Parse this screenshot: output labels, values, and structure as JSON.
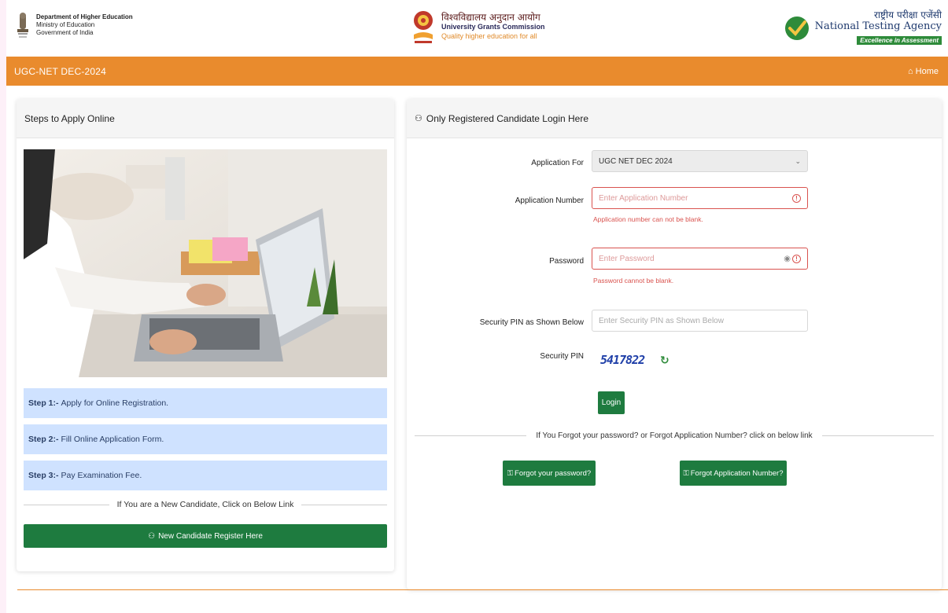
{
  "header": {
    "moe": {
      "line1": "Department of Higher Education",
      "line2": "Ministry of Education",
      "line3": "Government of India"
    },
    "ugc": {
      "hindi": "विश्वविद्यालय अनुदान आयोग",
      "name": "University Grants Commission",
      "tagline": "Quality higher education for all"
    },
    "nta": {
      "hindi": "राष्ट्रीय परीक्षा एजेंसी",
      "name": "National Testing Agency",
      "badge": "Excellence in Assessment"
    }
  },
  "nav": {
    "title": "UGC-NET DEC-2024",
    "home": "Home"
  },
  "left_card": {
    "title": "Steps to Apply Online",
    "steps": [
      {
        "prefix": "Step 1:-",
        "text": "Apply for Online Registration."
      },
      {
        "prefix": "Step 2:-",
        "text": "Fill Online Application Form."
      },
      {
        "prefix": "Step 3:-",
        "text": "Pay Examination Fee."
      }
    ],
    "new_candidate_text": "If You are a New Candidate, Click on Below Link",
    "register_button": "New Candidate Register Here"
  },
  "right_card": {
    "title": "Only Registered Candidate Login Here",
    "application_for": {
      "label": "Application For",
      "value": "UGC NET DEC 2024"
    },
    "application_number": {
      "label": "Application Number",
      "placeholder": "Enter Application Number",
      "error": "Application number can not be blank."
    },
    "password": {
      "label": "Password",
      "placeholder": "Enter Password",
      "error": "Password cannot be blank."
    },
    "security_pin_input": {
      "label": "Security PIN as Shown Below",
      "placeholder": "Enter Security PIN as Shown Below"
    },
    "security_pin": {
      "label": "Security PIN",
      "value": "5417822"
    },
    "login_button": "Login",
    "forgot_text": "If You Forgot your password? or Forgot Application Number? click on below link",
    "forgot_password_button": "Forgot your password?",
    "forgot_appno_button": "Forgot Application Number?"
  },
  "colors": {
    "orange": "#e98b2d",
    "green": "#1e7b3f",
    "step_bg": "#cfe2ff",
    "error": "#d9534f"
  }
}
